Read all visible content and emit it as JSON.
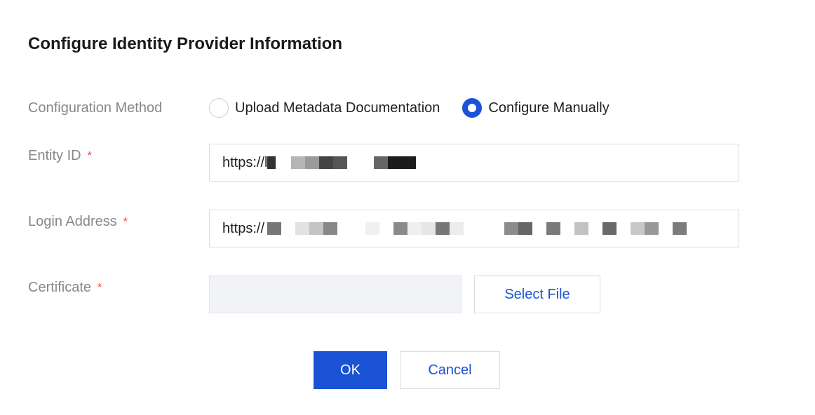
{
  "dialog": {
    "title": "Configure Identity Provider Information"
  },
  "form": {
    "method": {
      "label": "Configuration Method",
      "options": [
        {
          "label": "Upload Metadata Documentation",
          "checked": false
        },
        {
          "label": "Configure Manually",
          "checked": true
        }
      ]
    },
    "entity_id": {
      "label": "Entity ID",
      "required_mark": "*",
      "value": "https://l"
    },
    "login_address": {
      "label": "Login Address",
      "required_mark": "*",
      "value": "https://"
    },
    "certificate": {
      "label": "Certificate",
      "required_mark": "*",
      "select_label": "Select File"
    }
  },
  "footer": {
    "ok_label": "OK",
    "cancel_label": "Cancel"
  },
  "colors": {
    "primary": "#1b53d6",
    "required": "#e54545",
    "label_gray": "#888888"
  }
}
